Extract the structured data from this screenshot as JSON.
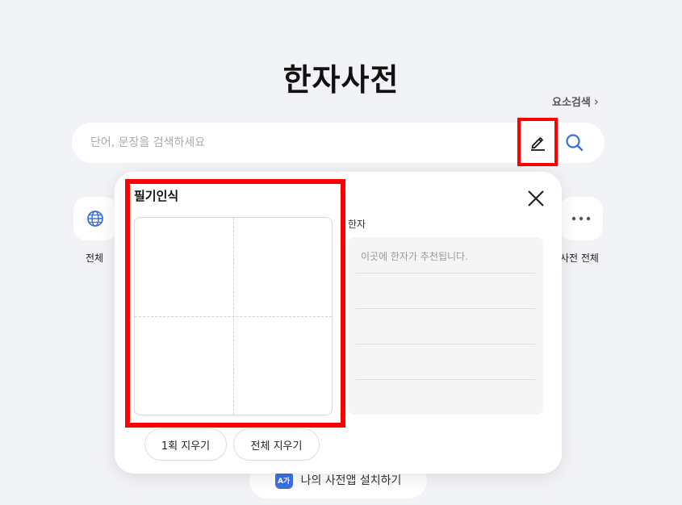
{
  "title": "한자사전",
  "component_search": {
    "label": "요소검색",
    "chevron": "›"
  },
  "search": {
    "placeholder": "단어, 문장을 검색하세요",
    "value": ""
  },
  "icons": {
    "pen": "pen-icon",
    "search": "search-icon",
    "close": "close-icon",
    "globe": "globe-icon",
    "more": "more-icon"
  },
  "categories": [
    {
      "label": "전체",
      "icon": "globe-icon"
    },
    {
      "label": "사전 전체",
      "icon": "more-icon"
    }
  ],
  "install": {
    "icon_text": "A가",
    "label": "나의 사전앱 설치하기"
  },
  "handwriting": {
    "title": "필기인식",
    "result_label": "한자",
    "result_placeholder": "이곳에 한자가 추천됩니다.",
    "undo_stroke_label": "1획 지우기",
    "clear_all_label": "전체 지우기"
  },
  "colors": {
    "highlight": "#ff0000",
    "accent": "#3b6fe0",
    "background": "#f2f3f6"
  }
}
